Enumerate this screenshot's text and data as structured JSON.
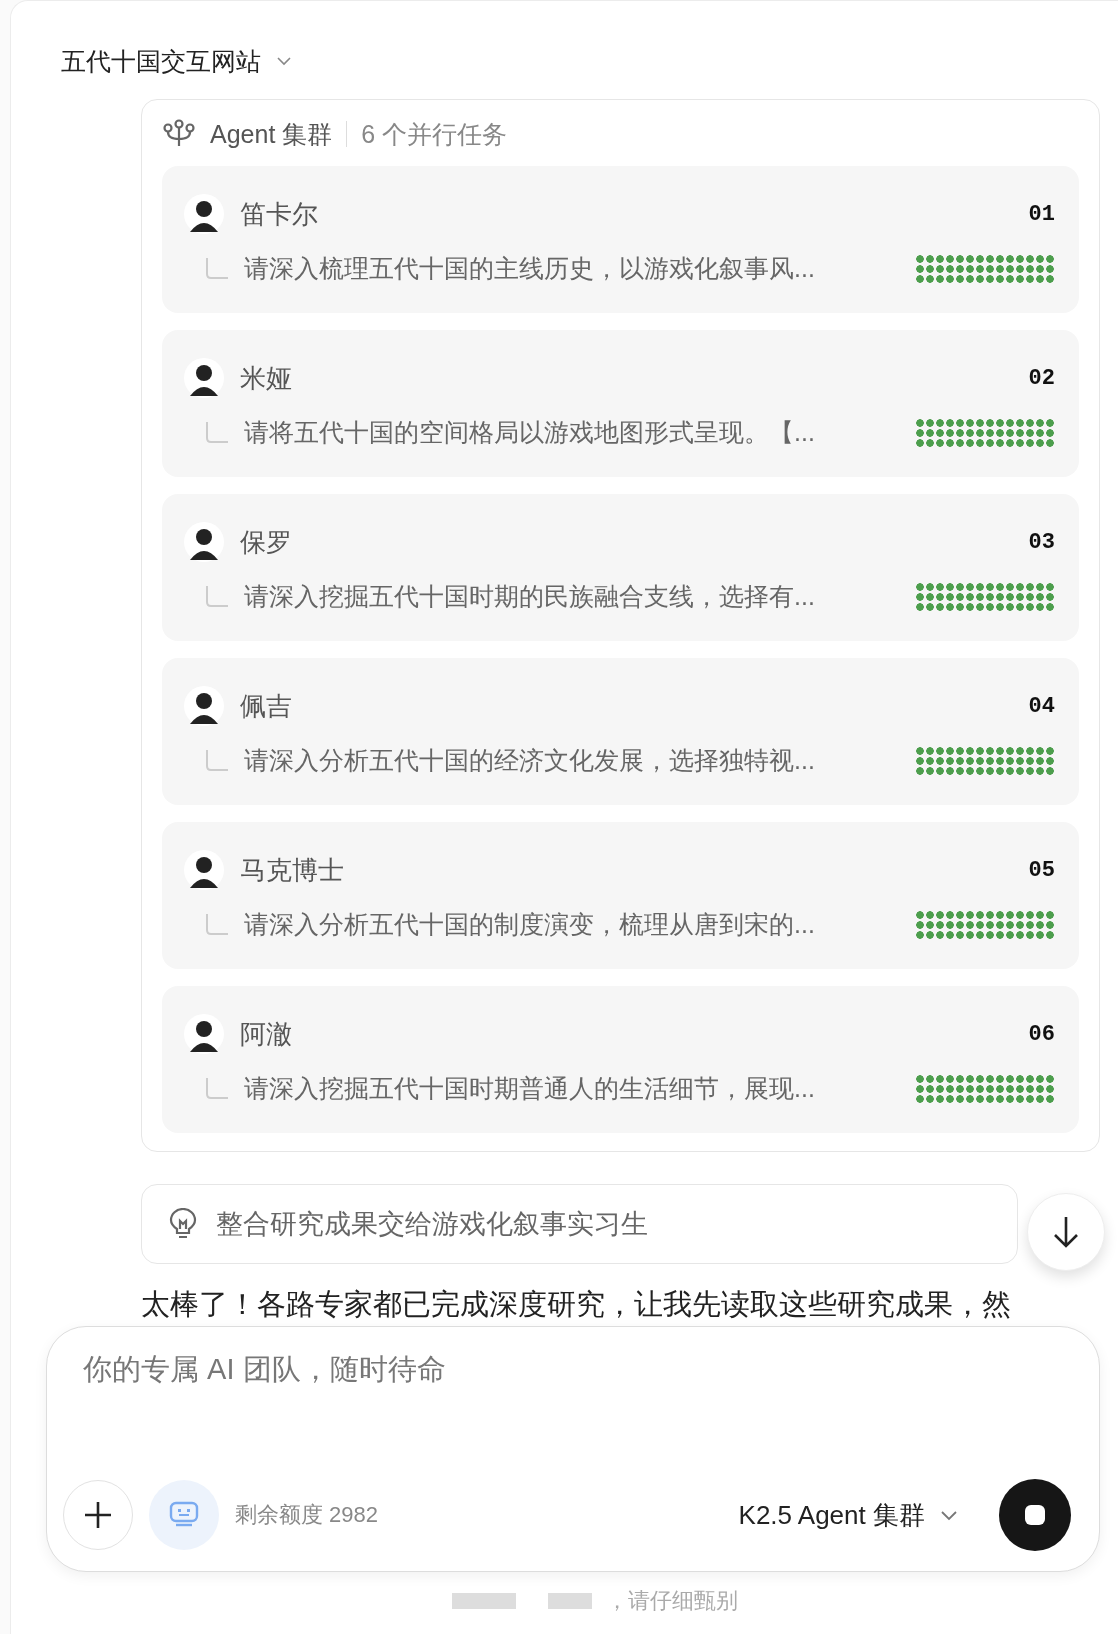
{
  "title": "五代十国交互网站",
  "agent_panel": {
    "label": "Agent 集群",
    "count": "6 个并行任务",
    "tasks": [
      {
        "name": "笛卡尔",
        "number": "01",
        "text": "请深入梳理五代十国的主线历史，以游戏化叙事风...",
        "level": 1
      },
      {
        "name": "米娅",
        "number": "02",
        "text": "请将五代十国的空间格局以游戏地图形式呈现。【...",
        "level": 1
      },
      {
        "name": "保罗",
        "number": "03",
        "text": "请深入挖掘五代十国时期的民族融合支线，选择有...",
        "level": 1
      },
      {
        "name": "佩吉",
        "number": "04",
        "text": "请深入分析五代十国的经济文化发展，选择独特视...",
        "level": 1
      },
      {
        "name": "马克博士",
        "number": "05",
        "text": "请深入分析五代十国的制度演变，梳理从唐到宋的...",
        "level": 1
      },
      {
        "name": "阿澈",
        "number": "06",
        "text": "请深入挖掘五代十国时期普通人的生活细节，展现...",
        "level": 1
      }
    ]
  },
  "suggestion": "整合研究成果交给游戏化叙事实习生",
  "reply_text": "太棒了！各路专家都已完成深度研究，让我先读取这些研究成果，然",
  "composer": {
    "placeholder": "你的专属 AI 团队，随时待命",
    "quota": "剩余额度 2982",
    "model": "K2.5 Agent 集群"
  },
  "disclaimer": "，请仔细甄别"
}
